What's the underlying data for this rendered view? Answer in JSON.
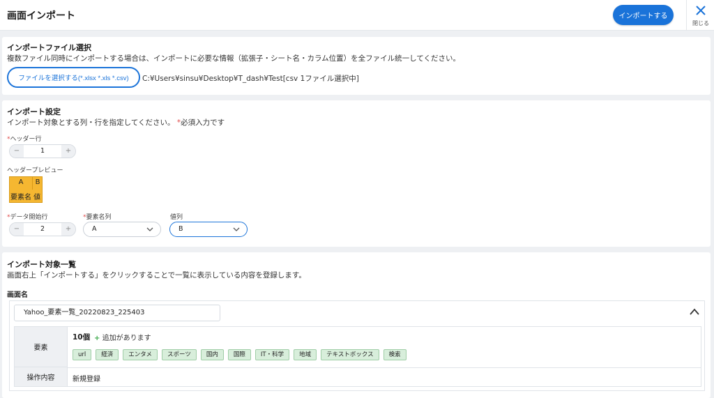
{
  "header": {
    "title": "画面インポート",
    "import_button": "インポートする",
    "close_label": "閉じる"
  },
  "file_section": {
    "title": "インポートファイル選択",
    "description": "複数ファイル同時にインポートする場合は、インポートに必要な情報（拡張子・シート名・カラム位置）を全ファイル統一してください。",
    "select_button": "ファイルを選択する(*.xlsx *.xls *.csv)",
    "path": "C:¥Users¥sinsu¥Desktop¥T_dash¥Test[csv 1ファイル選択中]"
  },
  "settings_section": {
    "title": "インポート設定",
    "description": "インポート対象とする列・行を指定してください。",
    "required_note": "必須入力です",
    "required_mark": "*",
    "header_row_label": "ヘッダー行",
    "header_row_value": "1",
    "minus": "−",
    "plus": "+",
    "preview_label": "ヘッダープレビュー",
    "preview": {
      "col_a": "A",
      "col_b": "B",
      "names": "要素名 値"
    },
    "data_start_label": "データ開始行",
    "data_start_value": "2",
    "element_col_label": "要素名列",
    "element_col_value": "A",
    "value_col_label": "値列",
    "value_col_value": "B"
  },
  "targets_section": {
    "title": "インポート対象一覧",
    "description": "画面右上「インポートする」をクリックすることで一覧に表示している内容を登録します。",
    "screen_name_label": "画面名",
    "screen_name_value": "Yahoo_要素一覧_20220823_225403",
    "elements_label": "要素",
    "elements_count": "10個",
    "add_plus": "+",
    "add_note": "追加があります",
    "tags": [
      "url",
      "経済",
      "エンタメ",
      "スポーツ",
      "国内",
      "国際",
      "IT・科学",
      "地域",
      "テキストボックス",
      "検索"
    ],
    "operation_label": "操作内容",
    "operation_value": "新規登録"
  },
  "colors": {
    "accent": "#1a73d9",
    "required": "#e04848",
    "preview_fill": "#f5b731",
    "tag_fill": "#d8eedb",
    "add_plus": "#3eaa4d"
  }
}
